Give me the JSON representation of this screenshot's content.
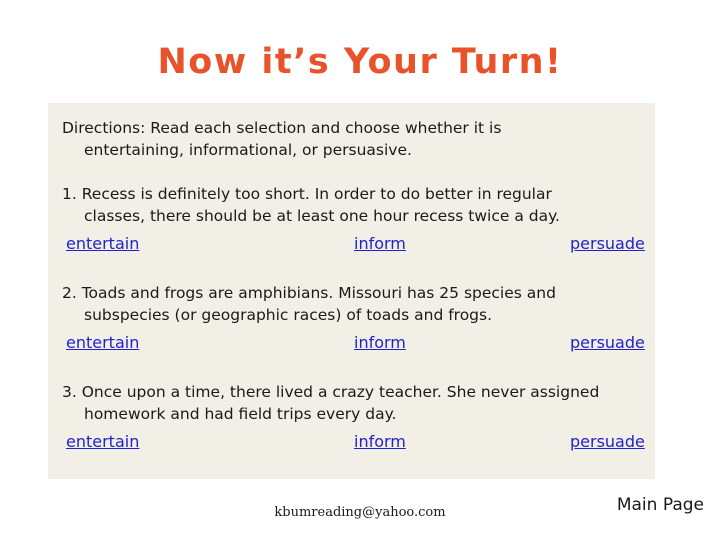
{
  "slide": {
    "title": "Now it’s Your Turn!",
    "directions_line1": "Directions: Read each selection and choose whether it is",
    "directions_line2": "entertaining, informational, or persuasive.",
    "items": [
      {
        "text_line1": "1. Recess is definitely too short. In order to do better in regular",
        "text_line2": "classes, there should be at least one hour recess twice a day.",
        "choices": [
          "entertain",
          "inform",
          "persuade"
        ]
      },
      {
        "text_line1": "2. Toads and frogs are amphibians. Missouri has 25 species and",
        "text_line2": "subspecies (or geographic races) of toads and frogs.",
        "choices": [
          "entertain",
          "inform",
          "persuade"
        ]
      },
      {
        "text_line1": "3. Once upon a time, there lived a crazy teacher. She never assigned",
        "text_line2": "homework and had field trips every day.",
        "choices": [
          "entertain",
          "inform",
          "persuade"
        ]
      }
    ],
    "email": "kbumreading@yahoo.com",
    "main_page_link": "Main Page",
    "colors": {
      "title": "#E8532B",
      "panel": "#F2EFE6",
      "link": "#2222CC"
    }
  }
}
